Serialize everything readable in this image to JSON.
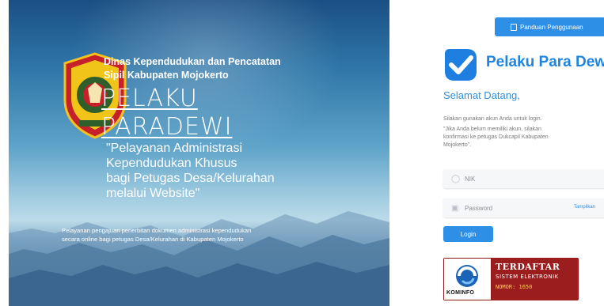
{
  "hero": {
    "agency_line1": "Dinas Kependudukan dan Pencatatan",
    "agency_line2": "Sipil Kabupaten Mojokerto",
    "app_title_line1": "PELAKU",
    "app_title_line2": "PARADEWI",
    "tagline_line1": "\"Pelayanan Administrasi",
    "tagline_line2": "Kependudukan Khusus",
    "tagline_line3": "bagi Petugas Desa/Kelurahan",
    "tagline_line4": "melalui Website\"",
    "desc_line1": "Pelayanan pengajuan penerbitan dokumen administrasi kependudukan",
    "desc_line2": "secara online bagi petugas Desa/Kelurahan di Kabupaten Mojokerto"
  },
  "header": {
    "guide_button": "Panduan Penggunaan",
    "guide_icon": "book-icon"
  },
  "brand": {
    "name": "Pelaku Para Dewi",
    "logo_icon": "checkmark-badge-icon"
  },
  "login": {
    "welcome": "Selamat Datang,",
    "info_line1": "Silakan gunakan akun Anda untuk login.",
    "info_line2": "\"Jika Anda belum memiliki akun, silakan",
    "info_line3": "konfirmasi ke petugas Dukcapil Kabupaten",
    "info_line4": "Mojokerto\".",
    "nik_placeholder": "NIK",
    "nik_icon": "user-icon",
    "password_placeholder": "Password",
    "password_icon": "lock-icon",
    "show_password": "Tampilkan",
    "login_button": "Login"
  },
  "badge": {
    "logo_text": "KOMINFO",
    "line1": "TERDAFTAR",
    "line2": "SISTEM ELEKTRONIK",
    "line3": "NOMOR: 1650"
  },
  "colors": {
    "accent": "#2d8fe6",
    "brand_text": "#1d84df",
    "badge_red": "#9b1d1d",
    "badge_number": "#f2d24a"
  }
}
